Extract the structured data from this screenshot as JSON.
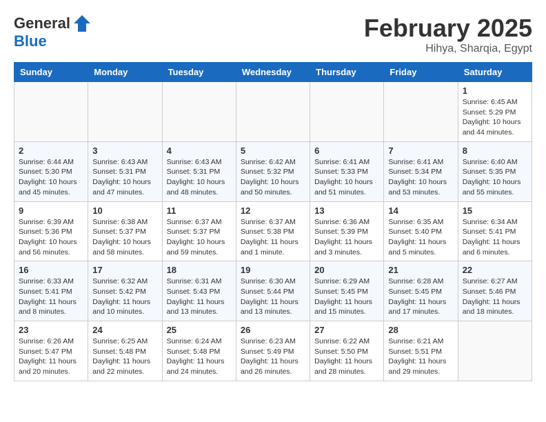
{
  "header": {
    "logo_line1": "General",
    "logo_line2": "Blue",
    "month": "February 2025",
    "location": "Hihya, Sharqia, Egypt"
  },
  "weekdays": [
    "Sunday",
    "Monday",
    "Tuesday",
    "Wednesday",
    "Thursday",
    "Friday",
    "Saturday"
  ],
  "weeks": [
    [
      {
        "day": "",
        "info": ""
      },
      {
        "day": "",
        "info": ""
      },
      {
        "day": "",
        "info": ""
      },
      {
        "day": "",
        "info": ""
      },
      {
        "day": "",
        "info": ""
      },
      {
        "day": "",
        "info": ""
      },
      {
        "day": "1",
        "info": "Sunrise: 6:45 AM\nSunset: 5:29 PM\nDaylight: 10 hours\nand 44 minutes."
      }
    ],
    [
      {
        "day": "2",
        "info": "Sunrise: 6:44 AM\nSunset: 5:30 PM\nDaylight: 10 hours\nand 45 minutes."
      },
      {
        "day": "3",
        "info": "Sunrise: 6:43 AM\nSunset: 5:31 PM\nDaylight: 10 hours\nand 47 minutes."
      },
      {
        "day": "4",
        "info": "Sunrise: 6:43 AM\nSunset: 5:31 PM\nDaylight: 10 hours\nand 48 minutes."
      },
      {
        "day": "5",
        "info": "Sunrise: 6:42 AM\nSunset: 5:32 PM\nDaylight: 10 hours\nand 50 minutes."
      },
      {
        "day": "6",
        "info": "Sunrise: 6:41 AM\nSunset: 5:33 PM\nDaylight: 10 hours\nand 51 minutes."
      },
      {
        "day": "7",
        "info": "Sunrise: 6:41 AM\nSunset: 5:34 PM\nDaylight: 10 hours\nand 53 minutes."
      },
      {
        "day": "8",
        "info": "Sunrise: 6:40 AM\nSunset: 5:35 PM\nDaylight: 10 hours\nand 55 minutes."
      }
    ],
    [
      {
        "day": "9",
        "info": "Sunrise: 6:39 AM\nSunset: 5:36 PM\nDaylight: 10 hours\nand 56 minutes."
      },
      {
        "day": "10",
        "info": "Sunrise: 6:38 AM\nSunset: 5:37 PM\nDaylight: 10 hours\nand 58 minutes."
      },
      {
        "day": "11",
        "info": "Sunrise: 6:37 AM\nSunset: 5:37 PM\nDaylight: 10 hours\nand 59 minutes."
      },
      {
        "day": "12",
        "info": "Sunrise: 6:37 AM\nSunset: 5:38 PM\nDaylight: 11 hours\nand 1 minute."
      },
      {
        "day": "13",
        "info": "Sunrise: 6:36 AM\nSunset: 5:39 PM\nDaylight: 11 hours\nand 3 minutes."
      },
      {
        "day": "14",
        "info": "Sunrise: 6:35 AM\nSunset: 5:40 PM\nDaylight: 11 hours\nand 5 minutes."
      },
      {
        "day": "15",
        "info": "Sunrise: 6:34 AM\nSunset: 5:41 PM\nDaylight: 11 hours\nand 6 minutes."
      }
    ],
    [
      {
        "day": "16",
        "info": "Sunrise: 6:33 AM\nSunset: 5:41 PM\nDaylight: 11 hours\nand 8 minutes."
      },
      {
        "day": "17",
        "info": "Sunrise: 6:32 AM\nSunset: 5:42 PM\nDaylight: 11 hours\nand 10 minutes."
      },
      {
        "day": "18",
        "info": "Sunrise: 6:31 AM\nSunset: 5:43 PM\nDaylight: 11 hours\nand 13 minutes."
      },
      {
        "day": "19",
        "info": "Sunrise: 6:30 AM\nSunset: 5:44 PM\nDaylight: 11 hours\nand 13 minutes."
      },
      {
        "day": "20",
        "info": "Sunrise: 6:29 AM\nSunset: 5:45 PM\nDaylight: 11 hours\nand 15 minutes."
      },
      {
        "day": "21",
        "info": "Sunrise: 6:28 AM\nSunset: 5:45 PM\nDaylight: 11 hours\nand 17 minutes."
      },
      {
        "day": "22",
        "info": "Sunrise: 6:27 AM\nSunset: 5:46 PM\nDaylight: 11 hours\nand 18 minutes."
      }
    ],
    [
      {
        "day": "23",
        "info": "Sunrise: 6:26 AM\nSunset: 5:47 PM\nDaylight: 11 hours\nand 20 minutes."
      },
      {
        "day": "24",
        "info": "Sunrise: 6:25 AM\nSunset: 5:48 PM\nDaylight: 11 hours\nand 22 minutes."
      },
      {
        "day": "25",
        "info": "Sunrise: 6:24 AM\nSunset: 5:48 PM\nDaylight: 11 hours\nand 24 minutes."
      },
      {
        "day": "26",
        "info": "Sunrise: 6:23 AM\nSunset: 5:49 PM\nDaylight: 11 hours\nand 26 minutes."
      },
      {
        "day": "27",
        "info": "Sunrise: 6:22 AM\nSunset: 5:50 PM\nDaylight: 11 hours\nand 28 minutes."
      },
      {
        "day": "28",
        "info": "Sunrise: 6:21 AM\nSunset: 5:51 PM\nDaylight: 11 hours\nand 29 minutes."
      },
      {
        "day": "",
        "info": ""
      }
    ]
  ]
}
